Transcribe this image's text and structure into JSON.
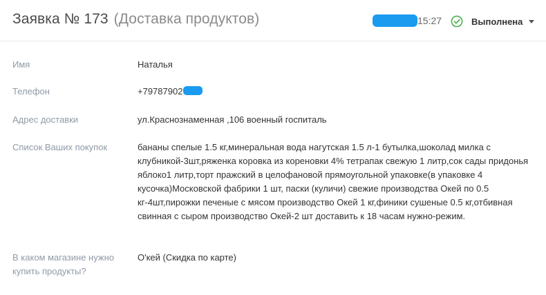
{
  "header": {
    "title": "Заявка № 173",
    "subtitle": "(Доставка продуктов)",
    "time": "15:27",
    "status": {
      "label": "Выполнена",
      "icon": "check-circle-icon",
      "icon_color": "#4caf50",
      "caret_icon": "caret-down-icon"
    }
  },
  "fields": {
    "name": {
      "label": "Имя",
      "value": "Наталья"
    },
    "phone": {
      "label": "Телефон",
      "value": "+79787902"
    },
    "address": {
      "label": "Адрес доставки",
      "value": "ул.Краснознаменная ,106 военный госпиталь"
    },
    "shopping_list": {
      "label": "Список Ваших покупок",
      "value": "бананы спелые 1.5 кг,минеральная вода нагутская 1.5 л-1 бутылка,шоколад милка с клубникой-3шт,ряженка коровка из кореновки 4% тетрапак свежую 1 литр,сок сады придонья яблоко1 литр,торт пражский в целофановой прямоугольной упаковке(в упаковке 4 кусочка)Московской фабрики 1 шт, паски (куличи) свежие производства Окей по 0.5 кг-4шт,пирожки печеные с мясом производство Окей 1 кг,финики сушеные 0.5 кг,отбивная свинная с сыром производство Окей-2 шт доставить к 18 часам нужно-режим."
    },
    "store": {
      "label": "В каком магазине нужно купить продукты?",
      "value": "О'кей (Скидка по карте)"
    }
  },
  "colors": {
    "label": "#8f9aa6",
    "redaction": "#1a9bef",
    "success": "#4caf50"
  }
}
